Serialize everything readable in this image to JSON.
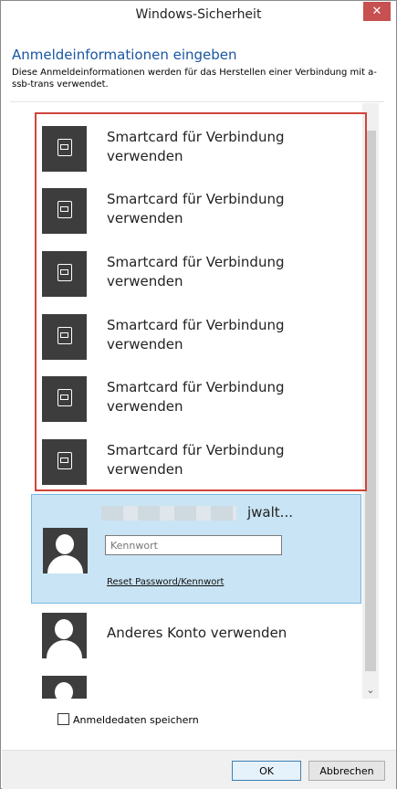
{
  "window": {
    "title": "Windows-Sicherheit",
    "close_label": "✕"
  },
  "header": {
    "title": "Anmeldeinformationen eingeben",
    "description": "Diese Anmeldeinformationen werden für das Herstellen einer Verbindung mit a-ssb-trans verwendet."
  },
  "smartcards": [
    {
      "label": "Smartcard für Verbindung verwenden"
    },
    {
      "label": "Smartcard für Verbindung verwenden"
    },
    {
      "label": "Smartcard für Verbindung verwenden"
    },
    {
      "label": "Smartcard für Verbindung verwenden"
    },
    {
      "label": "Smartcard für Verbindung verwenden"
    },
    {
      "label": "Smartcard für Verbindung verwenden"
    }
  ],
  "selected_account": {
    "user_suffix": "jwalt...",
    "password_placeholder": "Kennwort",
    "reset_link": "Reset Password/Kennwort"
  },
  "other_account": {
    "label": "Anderes Konto verwenden"
  },
  "options": {
    "save_credentials": "Anmeldedaten speichern"
  },
  "buttons": {
    "ok": "OK",
    "cancel": "Abbrechen"
  },
  "icons": {
    "card": "smartcard-icon",
    "user": "user-avatar-icon",
    "close": "close-icon",
    "scroll": "chevron-down-icon"
  },
  "colors": {
    "title_accent": "#1a56a0",
    "highlight_border": "#d0443a",
    "selected_background": "#c9e4f5",
    "close_button": "#c75050"
  }
}
